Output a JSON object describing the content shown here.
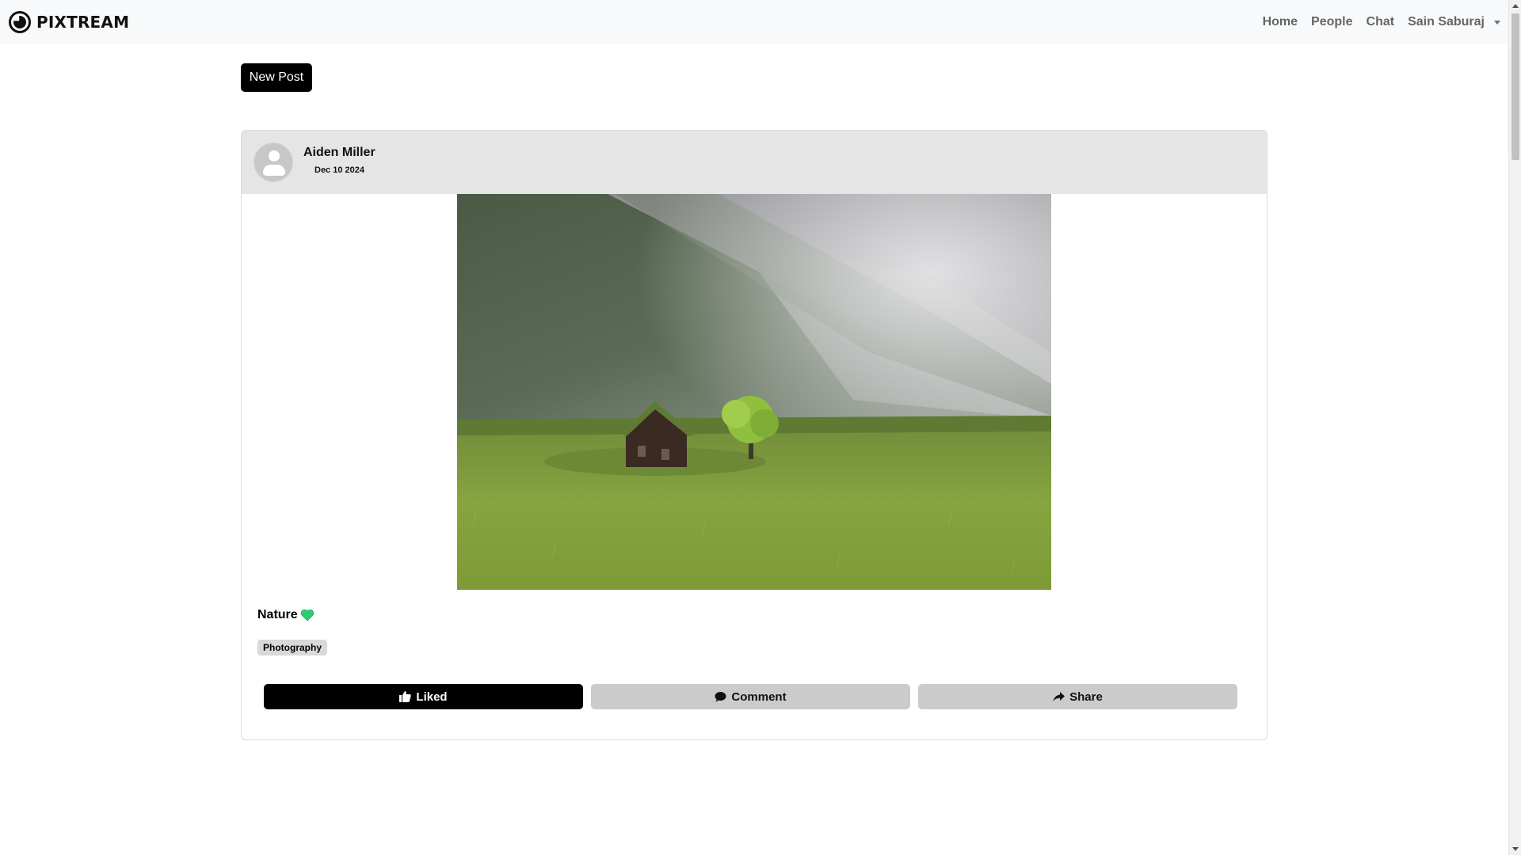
{
  "navbar": {
    "brand": "PIXTREAM",
    "links": {
      "home": "Home",
      "people": "People",
      "chat": "Chat"
    },
    "user": "Sain Saburaj"
  },
  "toolbar": {
    "new_post_label": "New Post"
  },
  "post": {
    "author": "Aiden Miller",
    "date": "Dec 10 2024",
    "caption": "Nature",
    "caption_emoji": "green-heart-icon",
    "tag": "Photography",
    "actions": {
      "like": "Liked",
      "comment": "Comment",
      "share": "Share"
    }
  },
  "colors": {
    "primary": "#000000",
    "navbar_bg": "#f8f9fa",
    "header_bg": "#e5e5e5",
    "neutral_btn": "#cbcbcb",
    "heart": "#2ecc71"
  }
}
